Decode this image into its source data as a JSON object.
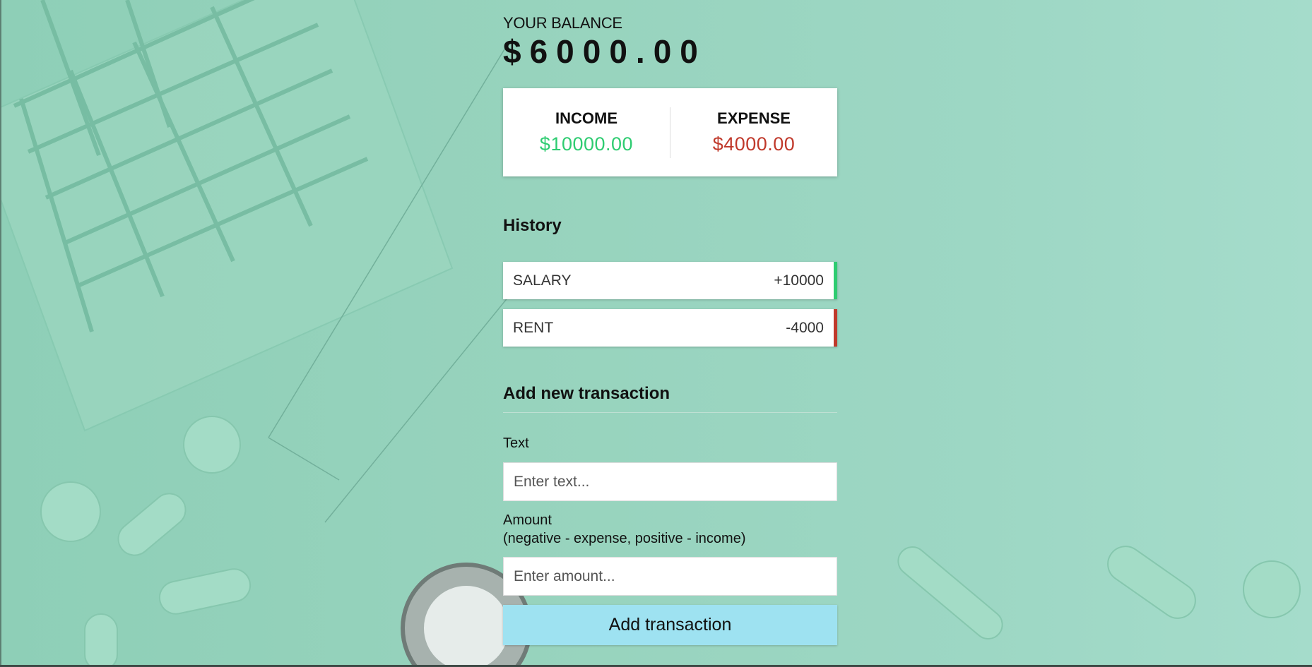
{
  "balance": {
    "label": "YOUR BALANCE",
    "amount": "$6000.00"
  },
  "summary": {
    "income_label": "INCOME",
    "income_value": "$10000.00",
    "expense_label": "EXPENSE",
    "expense_value": "$4000.00"
  },
  "history": {
    "title": "History",
    "items": [
      {
        "text": "SALARY",
        "amount": "+10000",
        "kind": "income"
      },
      {
        "text": "RENT",
        "amount": "-4000",
        "kind": "expense"
      }
    ]
  },
  "form": {
    "title": "Add new transaction",
    "text_label": "Text",
    "text_placeholder": "Enter text...",
    "amount_label": "Amount",
    "amount_hint": "(negative - expense, positive - income)",
    "amount_placeholder": "Enter amount...",
    "submit_label": "Add transaction"
  },
  "colors": {
    "income": "#2ecc71",
    "expense": "#c0392b",
    "button": "#9ee2f1",
    "background": "#97d3bd"
  }
}
